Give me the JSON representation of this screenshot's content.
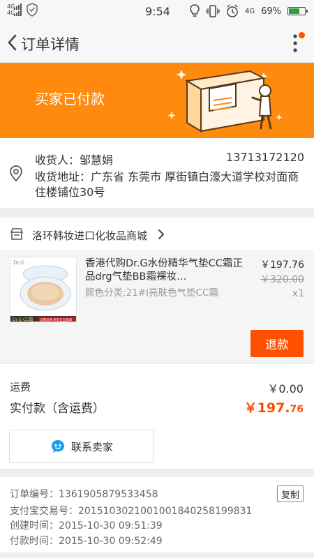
{
  "status_bar": {
    "network_top": "4G",
    "network_bottom": "4G",
    "time": "9:54",
    "network_right": "4G",
    "battery": "69%",
    "battery_level": 0.69
  },
  "header": {
    "title": "订单详情"
  },
  "banner": {
    "status": "买家已付款",
    "bg_color": "#ff8a0e"
  },
  "address": {
    "receiver": "收货人：邹慧娟",
    "phone": "13713172120",
    "address": "收货地址：广东省 东莞市 厚街镇白濠大道学校对面商住楼铺位30号"
  },
  "shop": {
    "name": "洛环韩妆进口化妆品商城"
  },
  "item": {
    "title": "香港代购Dr.G水份精华气垫CC霜正品drg气垫BB霜裸妆…",
    "sku": "颜色分类:21#I亮肤色气垫CC霜",
    "price": "￥197.76",
    "original_price": "￥320.00",
    "quantity": "x1",
    "thumb_brand": "Dr.G",
    "thumb_footer_left": "Dr.G CC霜",
    "thumb_footer_right": "全网品牌 原装正品直邮",
    "refund_label": "退款"
  },
  "totals": {
    "shipping_label": "运费",
    "shipping_value": "￥0.00",
    "paid_label": "实付款（含运费）",
    "paid_currency": "￥",
    "paid_integer": "197.",
    "paid_decimal": "76",
    "accent_color": "#ff5000"
  },
  "contact": {
    "label": "联系卖家"
  },
  "order_info": {
    "order_no": "订单编号：1361905879533458",
    "alipay_no": "支付宝交易号：2015103021001001840258199831",
    "created": "创建时间：2015-10-30 09:51:39",
    "paid": "付款时间：2015-10-30 09:52:49",
    "copy_label": "复制"
  }
}
